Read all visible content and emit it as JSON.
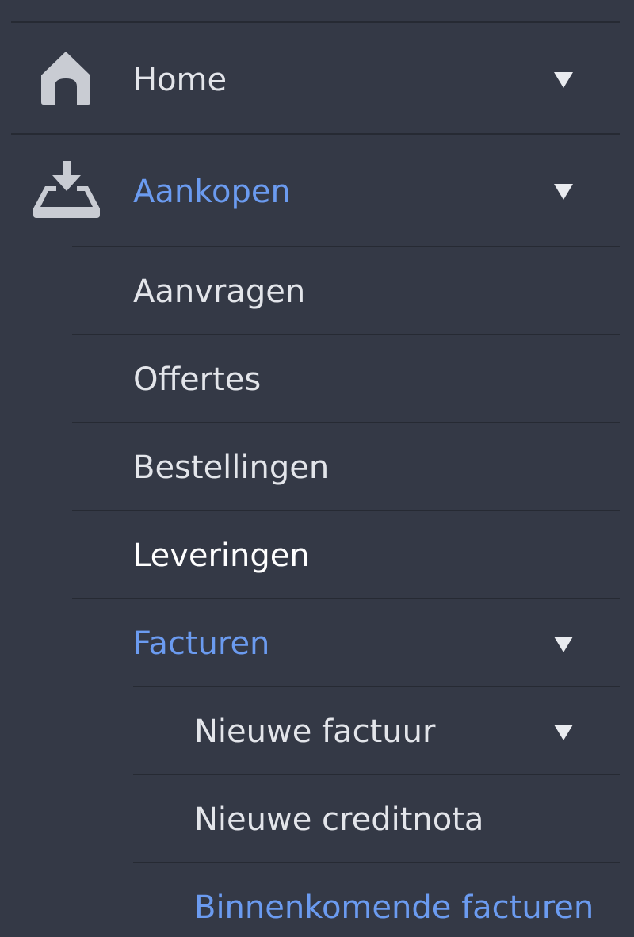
{
  "menu": {
    "home": {
      "label": "Home",
      "icon": "home-icon"
    },
    "aankopen": {
      "label": "Aankopen",
      "icon": "inbox-download-icon",
      "items": [
        {
          "label": "Aanvragen"
        },
        {
          "label": "Offertes"
        },
        {
          "label": "Bestellingen"
        },
        {
          "label": "Leveringen"
        }
      ],
      "facturen": {
        "label": "Facturen",
        "items": [
          {
            "label": "Nieuwe factuur"
          },
          {
            "label": "Nieuwe creditnota"
          },
          {
            "label": "Binnenkomende facturen"
          }
        ]
      }
    }
  },
  "colors": {
    "background": "#343946",
    "divider": "#262a33",
    "text": "#e3e5ea",
    "active": "#6b9bf0",
    "icon": "#c9ccd3"
  }
}
